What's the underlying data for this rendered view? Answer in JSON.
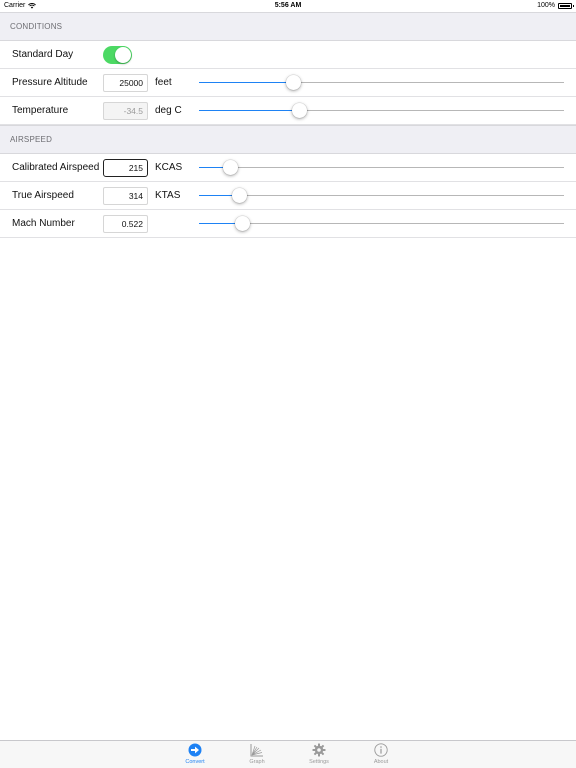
{
  "status_bar": {
    "carrier": "Carrier",
    "time": "5:56 AM",
    "battery": "100%"
  },
  "conditions": {
    "header": "CONDITIONS",
    "standard_day": {
      "label": "Standard Day",
      "on": true
    },
    "pressure_altitude": {
      "label": "Pressure Altitude",
      "value": "25000",
      "unit": "feet",
      "slider_percent": 25.8
    },
    "temperature": {
      "label": "Temperature",
      "value": "-34.5",
      "unit": "deg C",
      "slider_percent": 27.4
    }
  },
  "airspeed": {
    "header": "AIRSPEED",
    "calibrated": {
      "label": "Calibrated Airspeed",
      "value": "215",
      "unit": "KCAS",
      "slider_percent": 8.5
    },
    "true": {
      "label": "True Airspeed",
      "value": "314",
      "unit": "KTAS",
      "slider_percent": 11.2
    },
    "mach": {
      "label": "Mach Number",
      "value": "0.522",
      "unit": "",
      "slider_percent": 11.8
    }
  },
  "tab_bar": {
    "tabs": [
      {
        "label": "Convert",
        "icon": "arrow-right-circle-icon",
        "active": true
      },
      {
        "label": "Graph",
        "icon": "graph-icon",
        "active": false
      },
      {
        "label": "Settings",
        "icon": "gear-icon",
        "active": false
      },
      {
        "label": "About",
        "icon": "info-icon",
        "active": false
      }
    ]
  },
  "colors": {
    "accent": "#1e82f4",
    "toggle_on": "#4cd964",
    "section_bg": "#efeff4",
    "inactive_tab": "#9a9a9a"
  }
}
